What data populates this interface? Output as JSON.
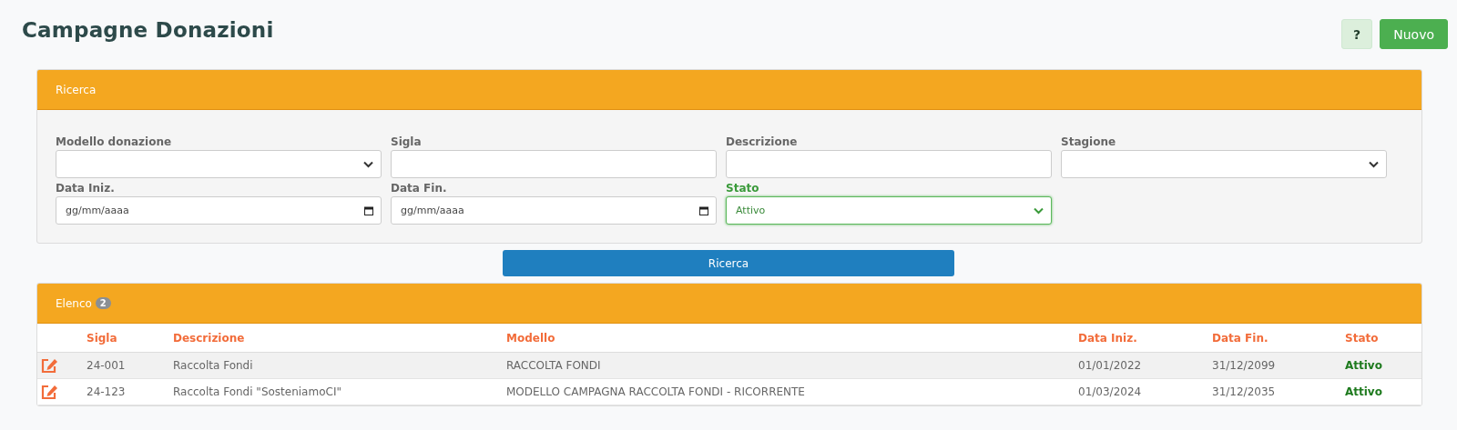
{
  "page_title": "Campagne Donazioni",
  "header_buttons": [
    {
      "kind": "help",
      "label": "?"
    },
    {
      "kind": "primary",
      "label": "Nuovo"
    }
  ],
  "search_panel": {
    "title": "Ricerca",
    "fields": [
      {
        "label": "Modello donazione",
        "kind": "select",
        "focused": false
      },
      {
        "label": "Sigla",
        "kind": "text",
        "focused": false
      },
      {
        "label": "Descrizione",
        "kind": "text",
        "focused": false
      },
      {
        "label": "Stagione",
        "kind": "select",
        "focused": false
      },
      {
        "label": "Data Iniz.",
        "kind": "date",
        "placeholder": "gg/mm/aaaa",
        "focused": false
      },
      {
        "label": "Data Fin.",
        "kind": "date",
        "placeholder": "gg/mm/aaaa",
        "focused": false
      },
      {
        "label": "Stato",
        "kind": "select",
        "value": "Attivo",
        "focused": true
      }
    ],
    "submit_label": "Ricerca"
  },
  "list_panel": {
    "title": "Elenco",
    "count": "2",
    "columns": [
      "Sigla",
      "Descrizione",
      "Modello",
      "Data Iniz.",
      "Data Fin.",
      "Stato"
    ],
    "rows": [
      {
        "sigla": "24-001",
        "descrizione": "Raccolta Fondi",
        "modello": "RACCOLTA FONDI",
        "data_iniz": "01/01/2022",
        "data_fin": "31/12/2099",
        "stato": "Attivo"
      },
      {
        "sigla": "24-123",
        "descrizione": "Raccolta Fondi \"SosteniamoCI\"",
        "modello": "MODELLO CAMPAGNA RACCOLTA FONDI - RICORRENTE",
        "data_iniz": "01/03/2024",
        "data_fin": "31/12/2035",
        "stato": "Attivo"
      }
    ]
  }
}
